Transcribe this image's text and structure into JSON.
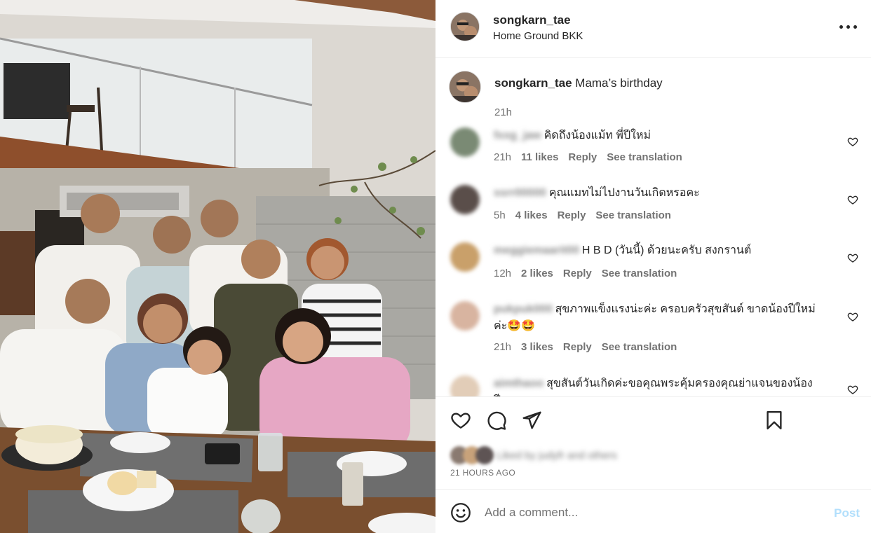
{
  "post": {
    "username": "songkarn_tae",
    "location": "Home Ground BKK",
    "caption": "Mama’s birthday",
    "caption_time": "21h",
    "posted_ago": "21 HOURS AGO",
    "liked_by": "Liked by judyfr and others"
  },
  "comments": [
    {
      "username": "fxxg_jaw",
      "text": "คิดถึงน้องแม้ท พี่ปีใหม่",
      "time": "21h",
      "likes": "11 likes",
      "reply": "Reply",
      "translate": "See translation",
      "avatar_color": "#7a8a74"
    },
    {
      "username": "ssrr00000",
      "text": "คุณแมทไม่ไปงานวันเกิดหรอคะ",
      "time": "5h",
      "likes": "4 likes",
      "reply": "Reply",
      "translate": "See translation",
      "avatar_color": "#5a4e4a"
    },
    {
      "username": "meggiemaarit00",
      "text": "H B D (วันนี้) ด้วยนะครับ สงกรานต์",
      "time": "12h",
      "likes": "2 likes",
      "reply": "Reply",
      "translate": "See translation",
      "avatar_color": "#c9a06a"
    },
    {
      "username": "pukpuk000",
      "text": "สุขภาพแข็งแรงน่ะค่ะ ครอบครัวสุขสันต์ ขาดน้องปีใหม่ค่ะ🤩🤩",
      "time": "21h",
      "likes": "3 likes",
      "reply": "Reply",
      "translate": "See translation",
      "avatar_color": "#d8b4a0"
    },
    {
      "username": "aimthaoo",
      "text": "สุขสันต์วันเกิดค่ะขอคุณพระคุ้มครองคุณย่าแจนของน้องปี",
      "time": "",
      "likes": "",
      "reply": "",
      "translate": "",
      "avatar_color": "#e2cdb8"
    }
  ],
  "input": {
    "placeholder": "Add a comment...",
    "post_label": "Post"
  },
  "icons": {
    "more": "more-horizontal-icon",
    "heart": "heart-icon",
    "comment": "comment-icon",
    "share": "share-icon",
    "save": "bookmark-icon",
    "emoji": "emoji-icon"
  },
  "colors": {
    "accent": "#0095f6",
    "post_disabled": "#b2dffc",
    "meta": "#737373",
    "text": "#262626"
  }
}
